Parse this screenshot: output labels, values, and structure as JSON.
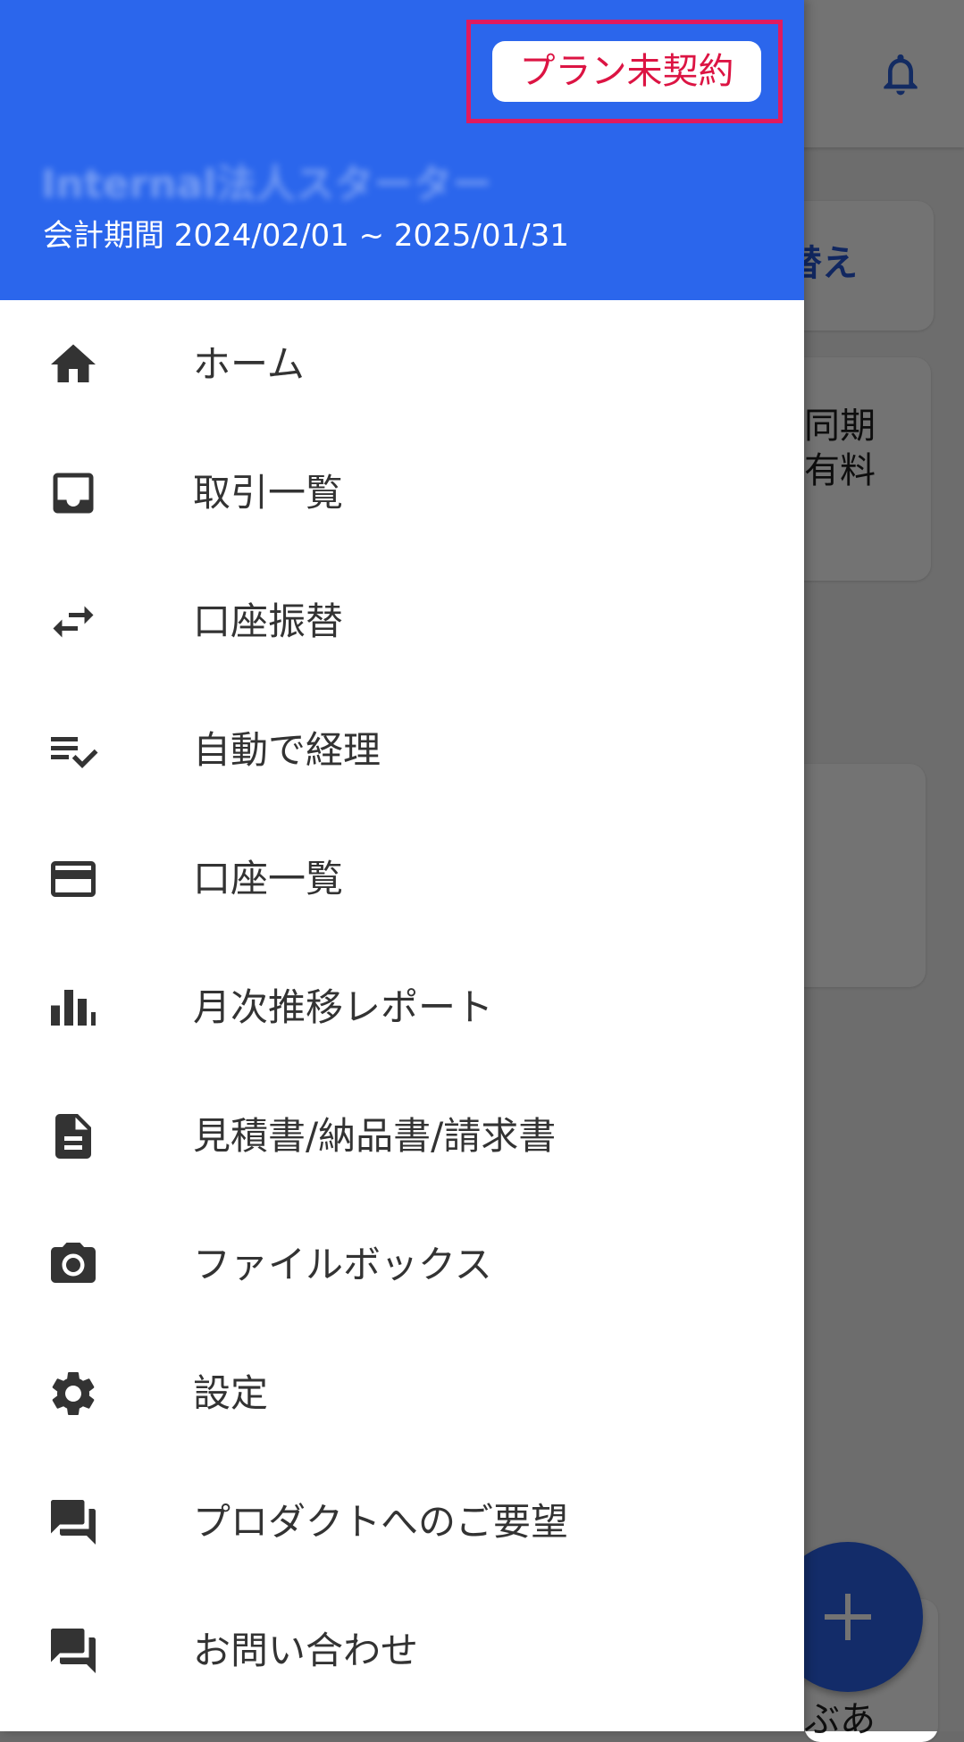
{
  "header": {
    "plan_badge": "プラン未契約",
    "org_name": "Internal法人スターター",
    "period": "会計期間 2024/02/01 ~ 2025/01/31"
  },
  "menu": [
    {
      "label": "ホーム",
      "icon": "home-icon"
    },
    {
      "label": "取引一覧",
      "icon": "inbox-icon"
    },
    {
      "label": "口座振替",
      "icon": "swap-arrows-icon"
    },
    {
      "label": "自動で経理",
      "icon": "checklist-icon"
    },
    {
      "label": "口座一覧",
      "icon": "credit-card-icon"
    },
    {
      "label": "月次推移レポート",
      "icon": "bar-chart-icon"
    },
    {
      "label": "見積書/納品書/請求書",
      "icon": "document-icon"
    },
    {
      "label": "ファイルボックス",
      "icon": "camera-icon"
    },
    {
      "label": "設定",
      "icon": "gear-icon"
    },
    {
      "label": "プロダクトへのご要望",
      "icon": "chat-icon"
    },
    {
      "label": "お問い合わせ",
      "icon": "chat-icon"
    }
  ],
  "background": {
    "switch_label": "替え",
    "sync_label": "同期",
    "paid_label": "有料",
    "bottom_label": "ぶあ"
  },
  "colors": {
    "header_blue": "#2b66ec",
    "plan_badge_text": "#dc1443",
    "highlight_border": "#e01a5e"
  }
}
